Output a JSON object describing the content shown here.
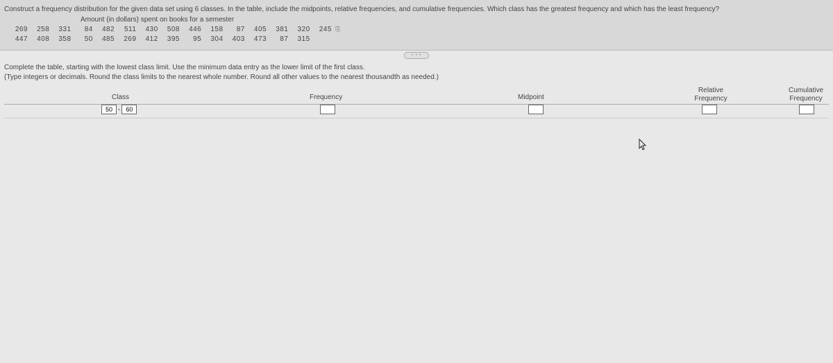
{
  "question": "Construct a frequency distribution for the given data set using 6 classes. In the table, include the midpoints, relative frequencies, and cumulative frequencies. Which class has the greatest frequency and which has the least frequency?",
  "data_label": "Amount (in dollars) spent on books for a semester",
  "data_values": {
    "row1": [
      "269",
      "258",
      "331",
      "84",
      "482",
      "511",
      "430",
      "508",
      "446",
      "158",
      "87",
      "405",
      "381",
      "320",
      "245"
    ],
    "row2": [
      "447",
      "408",
      "358",
      "50",
      "485",
      "269",
      "412",
      "395",
      "95",
      "304",
      "403",
      "473",
      "87",
      "315"
    ]
  },
  "instructions": {
    "line1": "Complete the table, starting with the lowest class limit. Use the minimum data entry as the lower limit of the first class.",
    "line2": "(Type integers or decimals. Round the class limits to the nearest whole number. Round all other values to the nearest thousandth as needed.)"
  },
  "columns": {
    "class": "Class",
    "frequency": "Frequency",
    "midpoint": "Midpoint",
    "relative": "Relative\nFrequency",
    "cumulative": "Cumulative\nFrequency"
  },
  "row1": {
    "class_low": "50",
    "class_high": "60",
    "frequency": "",
    "midpoint": "",
    "relative": "",
    "cumulative": ""
  },
  "pill": "• • •"
}
